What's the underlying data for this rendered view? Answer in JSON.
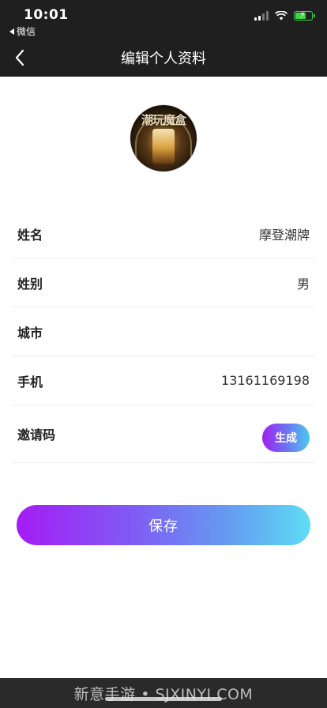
{
  "status_bar": {
    "time": "10:01",
    "back_app_label": "微信",
    "battery_level": 0.6
  },
  "navbar": {
    "title": "编辑个人资料"
  },
  "avatar": {
    "image_text": "潮玩魔盒"
  },
  "form": {
    "rows": [
      {
        "label": "姓名",
        "value": "摩登潮牌"
      },
      {
        "label": "姓别",
        "value": "男"
      },
      {
        "label": "城市",
        "value": ""
      },
      {
        "label": "手机",
        "value": "13161169198"
      },
      {
        "label": "邀请码",
        "value": "",
        "button_label": "生成"
      }
    ]
  },
  "save_button": {
    "label": "保存"
  },
  "footer": {
    "watermark": "新意手游 • SJXINYI.COM"
  },
  "colors": {
    "header_bg": "#1f1f1f",
    "gradient_start": "#a51cf5",
    "gradient_end": "#5fdcf5"
  }
}
